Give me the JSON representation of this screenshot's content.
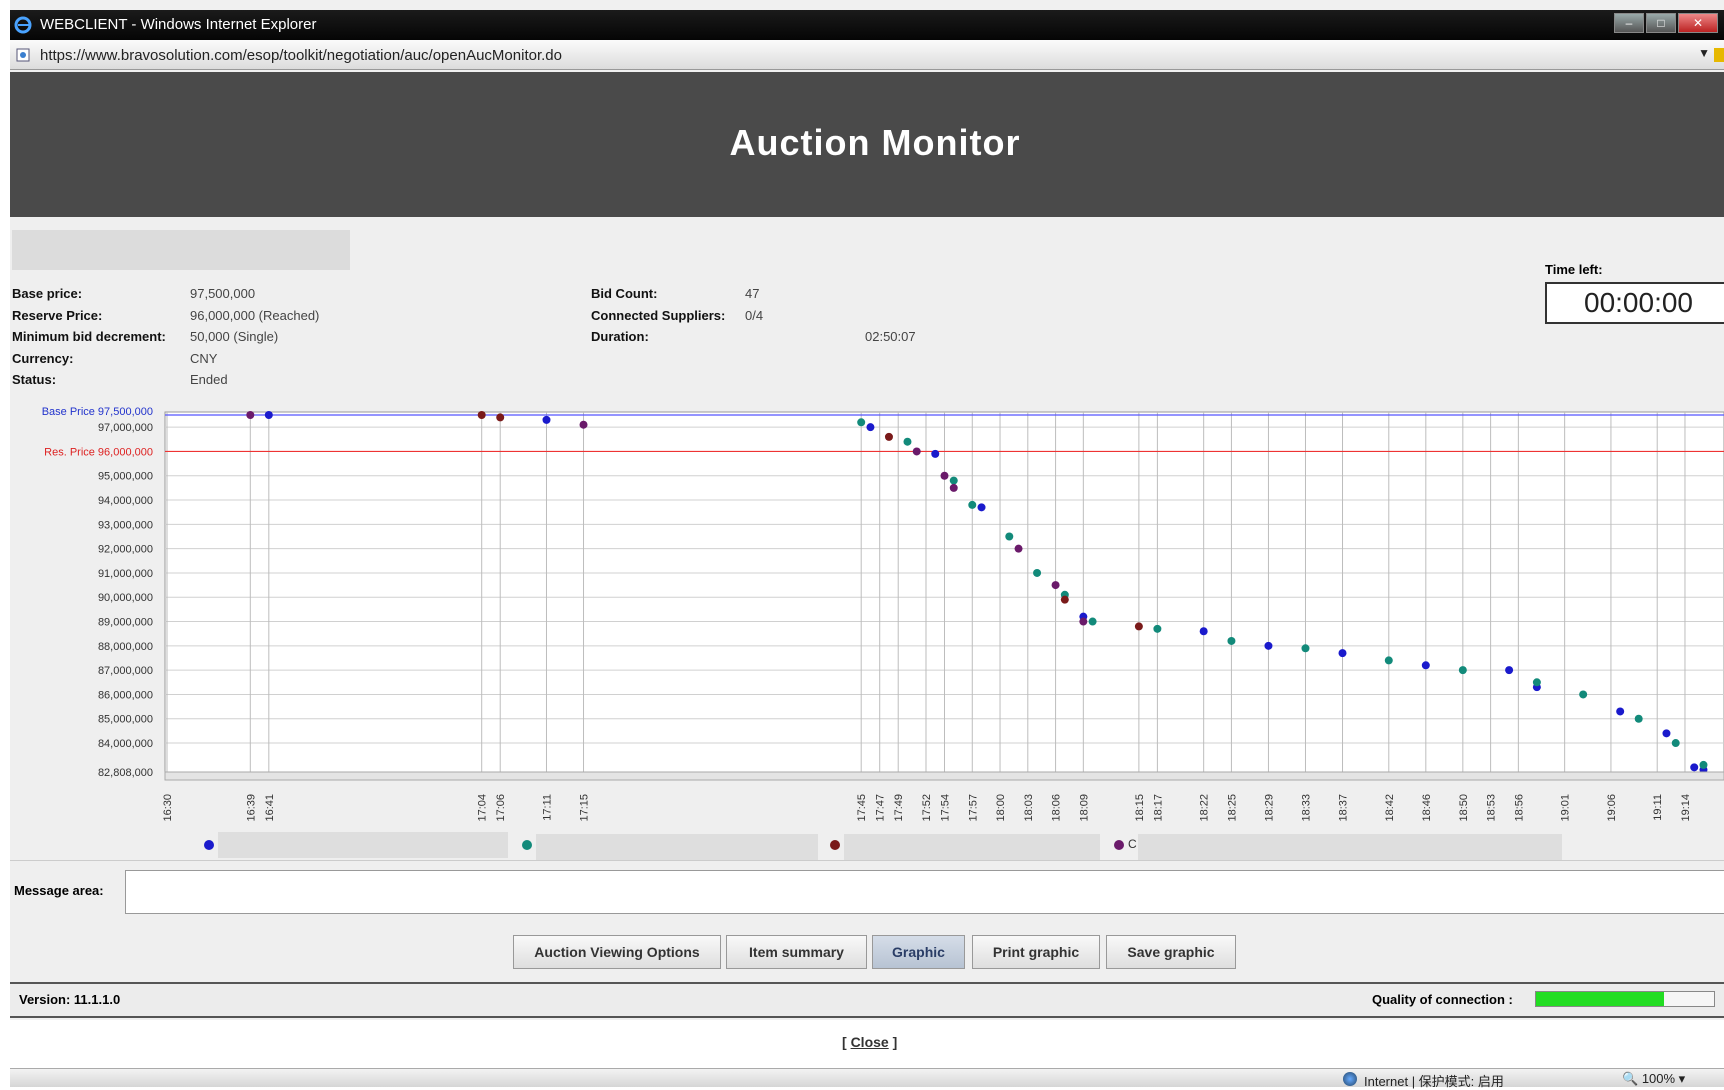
{
  "window": {
    "title": "WEBCLIENT - Windows Internet Explorer",
    "url": "https://www.bravosolution.com/esop/toolkit/negotiation/auc/openAucMonitor.do"
  },
  "header": {
    "title": "Auction Monitor"
  },
  "info": {
    "base_price_label": "Base price:",
    "base_price_value": "97,500,000",
    "reserve_price_label": "Reserve Price:",
    "reserve_price_value": "96,000,000 (Reached)",
    "min_bid_label": "Minimum bid decrement:",
    "min_bid_value": "50,000 (Single)",
    "currency_label": "Currency:",
    "currency_value": "CNY",
    "status_label": "Status:",
    "status_value": "Ended",
    "bid_count_label": "Bid Count:",
    "bid_count_value": "47",
    "connected_label": "Connected Suppliers:",
    "connected_value": "0/4",
    "duration_label": "Duration:",
    "duration_value": "02:50:07",
    "time_left_label": "Time left:",
    "time_left_value": "00:00:00"
  },
  "chart_data": {
    "type": "scatter",
    "base_line_label": "Base Price 97,500,000",
    "reserve_line_label": "Res. Price 96,000,000",
    "base_line_value": 97500000,
    "reserve_line_value": 96000000,
    "ylim": [
      82808000,
      97500000
    ],
    "y_ticks": [
      {
        "value": 97000000,
        "label": "97,000,000"
      },
      {
        "value": 95000000,
        "label": "95,000,000"
      },
      {
        "value": 94000000,
        "label": "94,000,000"
      },
      {
        "value": 93000000,
        "label": "93,000,000"
      },
      {
        "value": 92000000,
        "label": "92,000,000"
      },
      {
        "value": 91000000,
        "label": "91,000,000"
      },
      {
        "value": 90000000,
        "label": "90,000,000"
      },
      {
        "value": 89000000,
        "label": "89,000,000"
      },
      {
        "value": 88000000,
        "label": "88,000,000"
      },
      {
        "value": 87000000,
        "label": "87,000,000"
      },
      {
        "value": 86000000,
        "label": "86,000,000"
      },
      {
        "value": 85000000,
        "label": "85,000,000"
      },
      {
        "value": 84000000,
        "label": "84,000,000"
      },
      {
        "value": 82808000,
        "label": "82,808,000"
      }
    ],
    "x_unit": "minutes since 16:30",
    "x_ticks": [
      {
        "t": 0,
        "label": "16:30"
      },
      {
        "t": 9,
        "label": "16:39"
      },
      {
        "t": 11,
        "label": "16:41"
      },
      {
        "t": 34,
        "label": "17:04"
      },
      {
        "t": 36,
        "label": "17:06"
      },
      {
        "t": 41,
        "label": "17:11"
      },
      {
        "t": 45,
        "label": "17:15"
      },
      {
        "t": 75,
        "label": "17:45"
      },
      {
        "t": 77,
        "label": "17:47"
      },
      {
        "t": 79,
        "label": "17:49"
      },
      {
        "t": 82,
        "label": "17:52"
      },
      {
        "t": 84,
        "label": "17:54"
      },
      {
        "t": 87,
        "label": "17:57"
      },
      {
        "t": 90,
        "label": "18:00"
      },
      {
        "t": 93,
        "label": "18:03"
      },
      {
        "t": 96,
        "label": "18:06"
      },
      {
        "t": 99,
        "label": "18:09"
      },
      {
        "t": 105,
        "label": "18:15"
      },
      {
        "t": 107,
        "label": "18:17"
      },
      {
        "t": 112,
        "label": "18:22"
      },
      {
        "t": 115,
        "label": "18:25"
      },
      {
        "t": 119,
        "label": "18:29"
      },
      {
        "t": 123,
        "label": "18:33"
      },
      {
        "t": 127,
        "label": "18:37"
      },
      {
        "t": 132,
        "label": "18:42"
      },
      {
        "t": 136,
        "label": "18:46"
      },
      {
        "t": 140,
        "label": "18:50"
      },
      {
        "t": 143,
        "label": "18:53"
      },
      {
        "t": 146,
        "label": "18:56"
      },
      {
        "t": 151,
        "label": "19:01"
      },
      {
        "t": 156,
        "label": "19:06"
      },
      {
        "t": 161,
        "label": "19:11"
      },
      {
        "t": 164,
        "label": "19:14"
      }
    ],
    "series": [
      {
        "color": "#1a1acc",
        "points": [
          [
            11,
            97500000
          ],
          [
            41,
            97300000
          ],
          [
            76,
            97000000
          ],
          [
            83,
            95900000
          ],
          [
            88,
            93700000
          ],
          [
            99,
            89200000
          ],
          [
            112,
            88600000
          ],
          [
            119,
            88000000
          ],
          [
            127,
            87700000
          ],
          [
            136,
            87200000
          ],
          [
            145,
            87000000
          ],
          [
            148,
            86300000
          ],
          [
            157,
            85300000
          ],
          [
            162,
            84400000
          ],
          [
            165,
            83000000
          ],
          [
            166,
            82900000
          ]
        ]
      },
      {
        "color": "#128a7a",
        "points": [
          [
            75,
            97200000
          ],
          [
            80,
            96400000
          ],
          [
            85,
            94800000
          ],
          [
            87,
            93800000
          ],
          [
            91,
            92500000
          ],
          [
            94,
            91000000
          ],
          [
            97,
            90100000
          ],
          [
            100,
            89000000
          ],
          [
            107,
            88700000
          ],
          [
            115,
            88200000
          ],
          [
            123,
            87900000
          ],
          [
            132,
            87400000
          ],
          [
            140,
            87000000
          ],
          [
            148,
            86500000
          ],
          [
            153,
            86000000
          ],
          [
            159,
            85000000
          ],
          [
            163,
            84000000
          ],
          [
            166,
            83100000
          ]
        ]
      },
      {
        "color": "#7a1a1a",
        "points": [
          [
            34,
            97500000
          ],
          [
            36,
            97400000
          ],
          [
            78,
            96600000
          ],
          [
            97,
            89900000
          ],
          [
            105,
            88800000
          ]
        ]
      },
      {
        "color": "#6a1a6a",
        "points": [
          [
            9,
            97500000
          ],
          [
            45,
            97100000
          ],
          [
            81,
            96000000
          ],
          [
            84,
            95000000
          ],
          [
            85,
            94500000
          ],
          [
            92,
            92000000
          ],
          [
            96,
            90500000
          ],
          [
            99,
            89000000
          ]
        ]
      }
    ],
    "legend": [
      {
        "color": "#1a1acc"
      },
      {
        "color": "#128a7a"
      },
      {
        "color": "#7a1a1a"
      },
      {
        "color": "#6a1a6a",
        "label": "C"
      }
    ]
  },
  "message": {
    "label": "Message area:",
    "value": ""
  },
  "buttons": {
    "viewing_options": "Auction Viewing Options",
    "item_summary": "Item summary",
    "graphic": "Graphic",
    "print_graphic": "Print graphic",
    "save_graphic": "Save graphic"
  },
  "footer": {
    "version_label": "Version: 11.1.1.0",
    "quality_label": "Quality of connection :",
    "quality_fraction": 0.72,
    "close_label": "Close"
  },
  "ie_status": {
    "zone": "Internet | 保护模式: 启用",
    "zoom": "100%"
  }
}
